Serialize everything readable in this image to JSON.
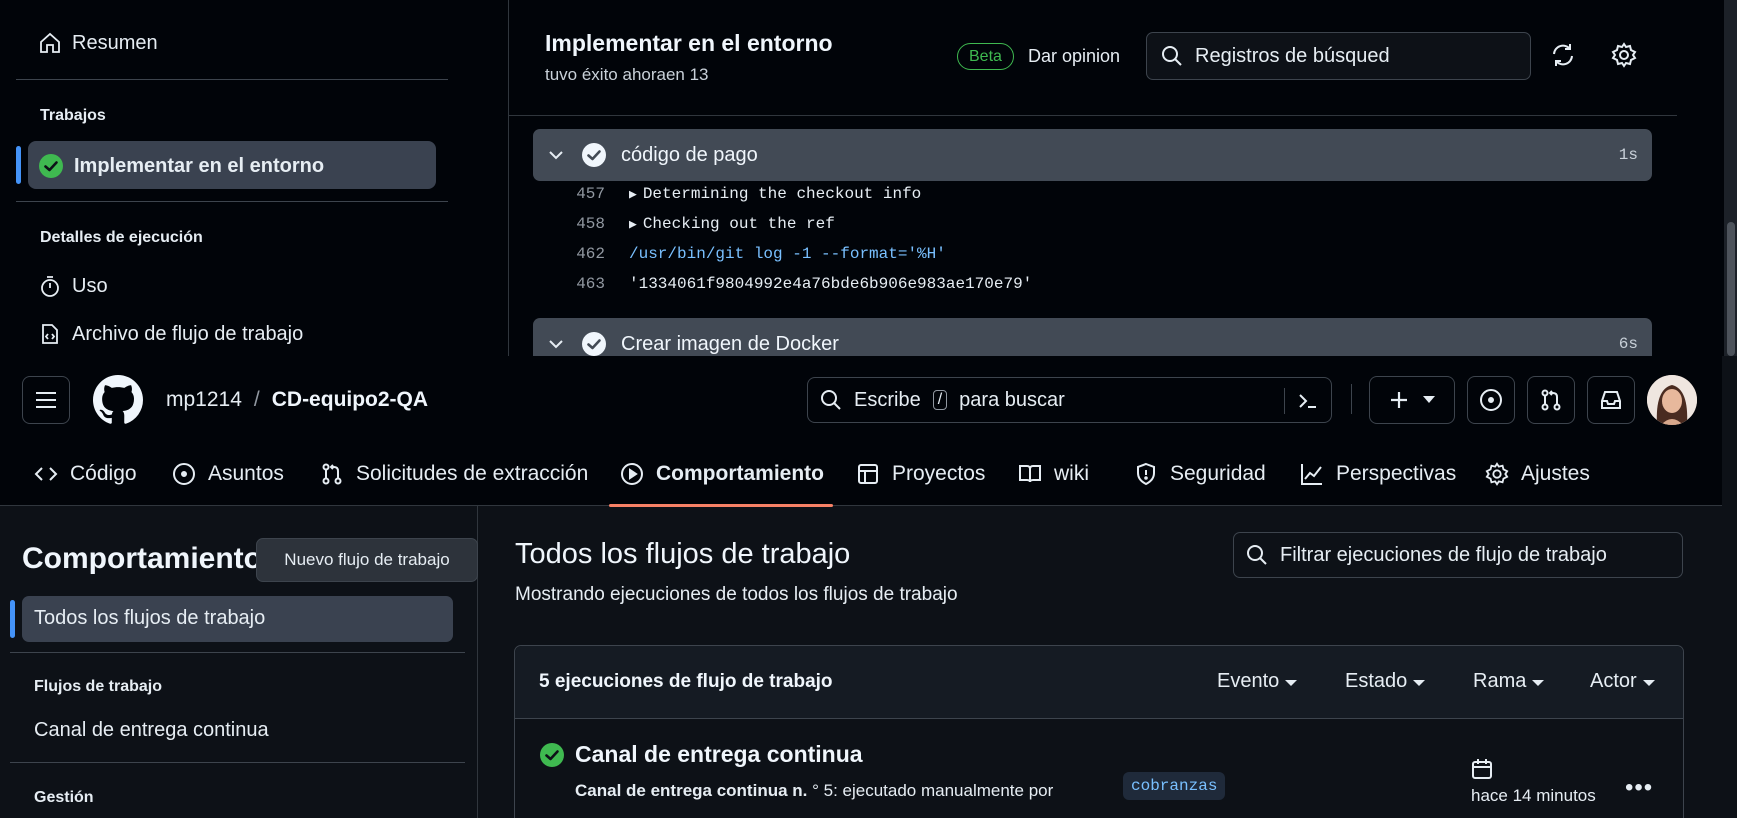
{
  "top_window": {
    "sidebar": {
      "summary_label": "Resumen",
      "jobs_heading": "Trabajos",
      "active_job_label": "Implementar en el entorno",
      "run_details_heading": "Detalles de ejecución",
      "usage_label": "Uso",
      "workflow_file_label": "Archivo de flujo de trabajo"
    },
    "job_header": {
      "title": "Implementar en el entorno",
      "subtitle": "tuvo éxito ahoraen 13",
      "beta_badge": "Beta",
      "feedback_link": "Dar opinion",
      "search_placeholder": "Registros de búsqued"
    },
    "steps": [
      {
        "label": "código de pago",
        "duration": "1s"
      },
      {
        "label": "Crear imagen de Docker",
        "duration": "6s"
      }
    ],
    "log_lines": [
      {
        "num": "457",
        "text": "Determining the checkout info",
        "collapsible": true
      },
      {
        "num": "458",
        "text": "Checking out the ref",
        "collapsible": true
      },
      {
        "num": "462",
        "text": "/usr/bin/git log -1 --format='%H'",
        "collapsible": false
      },
      {
        "num": "463",
        "text": "'1334061f9804992e4a76bde6b906e983ae170e79'",
        "collapsible": false
      }
    ]
  },
  "header": {
    "owner": "mp1214",
    "separator": "/",
    "repo": "CD-equipo2-QA",
    "search_prefix": "Escribe",
    "search_key": "/",
    "search_suffix": "para buscar",
    "plus_label": "+"
  },
  "nav": {
    "tabs": [
      {
        "label": "Código",
        "icon": "code-icon"
      },
      {
        "label": "Asuntos",
        "icon": "issue-opened-icon"
      },
      {
        "label": "Solicitudes de extracción",
        "icon": "git-pull-request-icon"
      },
      {
        "label": "Comportamiento",
        "icon": "play-icon",
        "active": true
      },
      {
        "label": "Proyectos",
        "icon": "table-icon"
      },
      {
        "label": "wiki",
        "icon": "book-icon"
      },
      {
        "label": "Seguridad",
        "icon": "shield-icon"
      },
      {
        "label": "Perspectivas",
        "icon": "graph-icon"
      },
      {
        "label": "Ajustes",
        "icon": "gear-icon"
      }
    ]
  },
  "actions_sidebar": {
    "title": "Comportamiento",
    "new_workflow_button": "Nuevo flujo de trabajo",
    "all_workflows": "Todos los flujos de trabajo",
    "workflows_heading": "Flujos de trabajo",
    "workflow_item": "Canal de entrega continua",
    "management_heading": "Gestión"
  },
  "main": {
    "title": "Todos los flujos de trabajo",
    "subtitle": "Mostrando ejecuciones de todos los flujos de trabajo",
    "filter_placeholder": "Filtrar ejecuciones de flujo de trabajo",
    "runs_count": "5 ejecuciones de flujo de trabajo",
    "filters": [
      "Evento",
      "Estado",
      "Rama",
      "Actor"
    ],
    "run": {
      "title": "Canal de entrega continua",
      "desc_bold": "Canal de entrega continua n.",
      "desc_rest": " ° 5: ejecutado manualmente por",
      "branch": "cobranzas",
      "time": "hace 14 minutos",
      "more": "•••"
    }
  },
  "colors": {
    "success": "#3fb950",
    "accent": "#4493f8",
    "tab_underline": "#f78166"
  }
}
